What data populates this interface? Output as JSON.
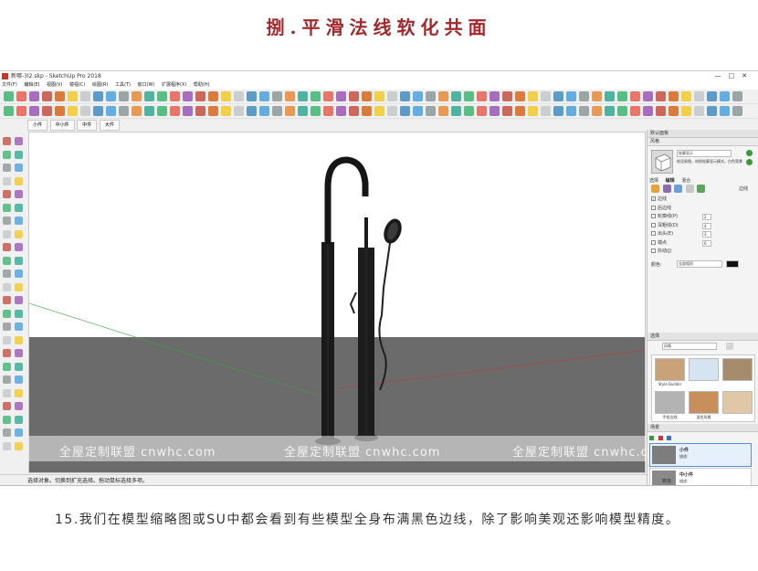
{
  "heading": "捌.平滑法线软化共面",
  "app": {
    "title": "新哪-3l2.skp - SketchUp Pro 2018",
    "menu": [
      "文件(F)",
      "编辑(E)",
      "视图(V)",
      "镜视(C)",
      "绘图(R)",
      "工具(T)",
      "窗口(W)",
      "扩展程序(X)",
      "帮助(H)"
    ],
    "scene_tabs": [
      "小件",
      "中小件",
      "中件",
      "大件"
    ],
    "status_text": "选择对象。切换到扩充选择。拖动鼠标选择多项。"
  },
  "tray": {
    "default_panel_title": "默认面板",
    "styles_header": "风格",
    "style_name": "轮廓显示",
    "style_desc": "绘设易隐，材质轮廓显示模式。白色背景",
    "tabs": [
      "选择",
      "编辑",
      "混合"
    ],
    "edge_section": "边线",
    "edge_options": [
      {
        "label": "边线",
        "checked": true,
        "value": ""
      },
      {
        "label": "后边线",
        "checked": false,
        "value": ""
      },
      {
        "label": "轮廓线(P)",
        "checked": false,
        "value": "2"
      },
      {
        "label": "深粗线(D)",
        "checked": false,
        "value": "4"
      },
      {
        "label": "出头(E)",
        "checked": false,
        "value": "3"
      },
      {
        "label": "端点",
        "checked": false,
        "value": "6"
      },
      {
        "label": "抖动(J)",
        "checked": false,
        "value": ""
      }
    ],
    "color_label": "颜色:",
    "color_value": "全部相同",
    "select_header": "选择",
    "style_dropdown": "风格",
    "thumbs": [
      "Style Builder",
      "",
      "",
      "手绘边线",
      "混合风格",
      ""
    ],
    "scenes_header": "场景",
    "scene_items": [
      {
        "name": "小件",
        "desc": "描述:"
      },
      {
        "name": "中小件",
        "desc": "描述:"
      }
    ],
    "data_label": "数值"
  },
  "watermark": [
    "全屋定制联盟 cnwhc.com",
    "全屋定制联盟 cnwhc.com",
    "全屋定制联盟 cnwhc.com"
  ],
  "caption": "15.我们在模型缩略图或SU中都会看到有些模型全身布满黑色边线，除了影响美观还影响模型精度。"
}
